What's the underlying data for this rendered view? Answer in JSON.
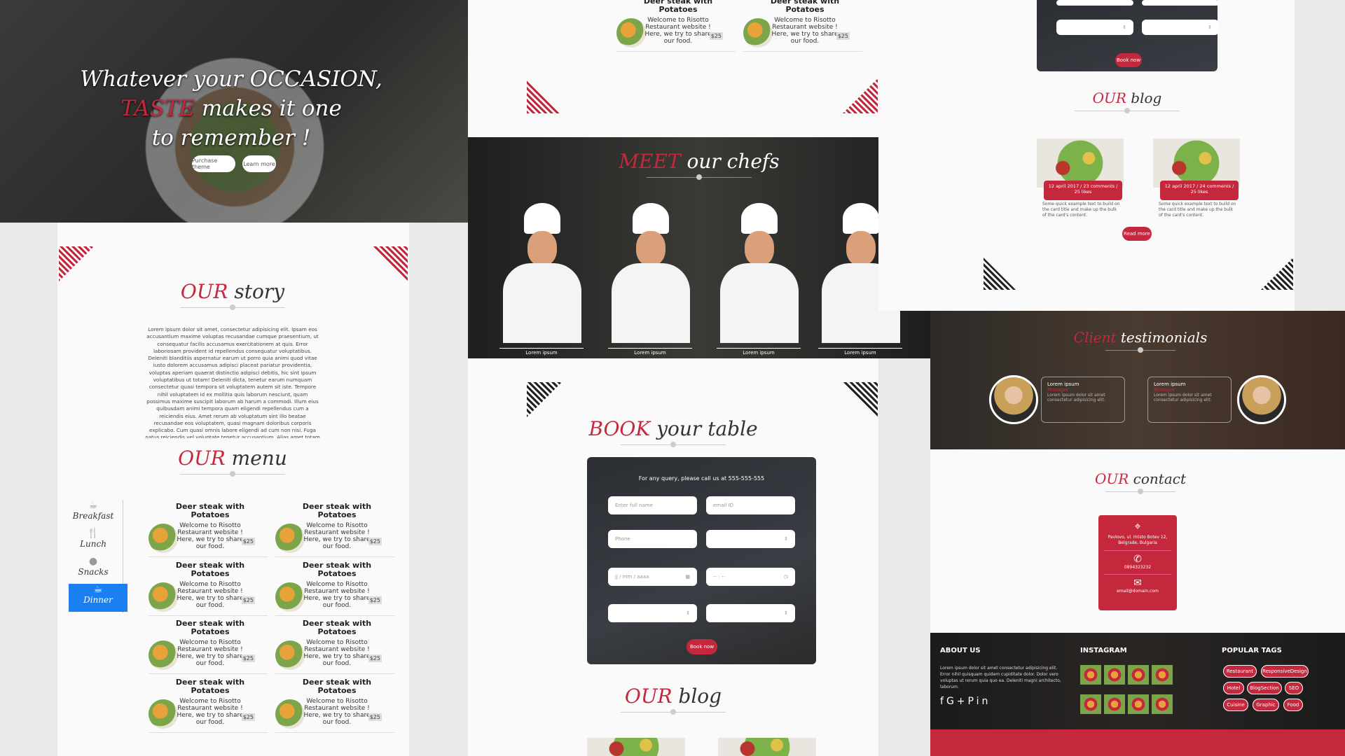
{
  "hero": {
    "line1": "Whatever your OCCASION,",
    "accent": "TASTE",
    "line2_rest": " makes it one",
    "line3": "to remember !",
    "btn_purchase": "Purchase theme",
    "btn_learn": "Learn more"
  },
  "story": {
    "h_accent": "OUR",
    "h_rest": " story",
    "body": "Lorem ipsum dolor sit amet, consectetur adipisicing elit. Ipsam eos accusantium maxime voluptas recusandae cumque praesentium, ut consequatur facilis accusamus exercitationem at quis. Error laboriosam provident id repellendus consequatur voluptatibus. Deleniti blanditiis aspernatur earum ut porro quia animi quod vitae iusto dolorem accusamus adipisci placeat pariatur providentia, voluptas aperiam quaerat distinctio adipisci debitis, hic sint ipsum voluptatibus ut totam! Deleniti dicta, tenetur earum numquam consectetur quasi tempora sit voluptatem autem sit iste. Tempore nihil voluptatem id ex mollitia quis laborum nesciunt, quam possimus maxime suscipit laborum ab harum a commodi. Illum eius quibusdam animi tempora quam eligendi repellendus cum a reiciendis eius. Amet rerum ab voluptatum sint illo beatae recusandae eos voluptatem, quasi magnam doloribus corporis explicabo. Cum quasi omnis labore eligendi ad cum non nisi. Fuga natus reiciendis vel voluptate tenetur accusantium. Alias amet totam nesciunt, quis magni."
  },
  "menu": {
    "h_accent": "OUR",
    "h_rest": " menu",
    "categories": [
      {
        "label": "Breakfast",
        "icon": "cup-icon"
      },
      {
        "label": "Lunch",
        "icon": "cutlery-icon"
      },
      {
        "label": "Snacks",
        "icon": "snack-icon"
      },
      {
        "label": "Dinner",
        "icon": "coffee-icon",
        "active": true
      }
    ],
    "items": [
      {
        "title": "Deer steak with Potatoes",
        "desc": "Welcome to Risotto Restaurant website ! Here, we try to share our food.",
        "price": "$25"
      },
      {
        "title": "Deer steak with Potatoes",
        "desc": "Welcome to Risotto Restaurant website ! Here, we try to share our food.",
        "price": "$25"
      },
      {
        "title": "Deer steak with Potatoes",
        "desc": "Welcome to Risotto Restaurant website ! Here, we try to share our food.",
        "price": "$25"
      },
      {
        "title": "Deer steak with Potatoes",
        "desc": "Welcome to Risotto Restaurant website ! Here, we try to share our food.",
        "price": "$25"
      },
      {
        "title": "Deer steak with Potatoes",
        "desc": "Welcome to Risotto Restaurant website ! Here, we try to share our food.",
        "price": "$25"
      },
      {
        "title": "Deer steak with Potatoes",
        "desc": "Welcome to Risotto Restaurant website ! Here, we try to share our food.",
        "price": "$25"
      },
      {
        "title": "Deer steak with Potatoes",
        "desc": "Welcome to Risotto Restaurant website ! Here, we try to share our food.",
        "price": "$25"
      },
      {
        "title": "Deer steak with Potatoes",
        "desc": "Welcome to Risotto Restaurant website ! Here, we try to share our food.",
        "price": "$25"
      }
    ],
    "top_items": [
      {
        "title": "Deer steak with Potatoes",
        "desc": "Welcome to Risotto Restaurant website ! Here, we try to share our food.",
        "price": "$25"
      },
      {
        "title": "Deer steak with Potatoes",
        "desc": "Welcome to Risotto Restaurant website ! Here, we try to share our food.",
        "price": "$25"
      }
    ]
  },
  "chefs": {
    "h_accent": "MEET",
    "h_rest": " our chefs",
    "names": [
      "Lorem ipsum",
      "Lorem ipsum",
      "Lorem ipsum",
      "Lorem ipsum"
    ]
  },
  "book": {
    "h_accent": "BOOK",
    "h_rest": " your table",
    "query": "For any query, please call us at 555-555-555",
    "name_ph": "Enter full name",
    "email_ph": "email ID",
    "phone_ph": "Phone",
    "date_ph": "jj / mm / aaaa",
    "time_ph": "-- : --",
    "btn": "Book now"
  },
  "blog": {
    "h_accent": "OUR",
    "h_rest": " blog",
    "posts": [
      {
        "meta": "12 april 2017 / 23 comments / 25 likes",
        "text": "Some quick example text to build on the card title and make up the bulk of the card's content."
      },
      {
        "meta": "12 april 2017 / 24 comments / 25 likes",
        "text": "Some quick example text to build on the card title and make up the bulk of the card's content."
      }
    ],
    "btn": "Read more"
  },
  "testimonials": {
    "h_accent": "Client",
    "h_rest": " testimonials",
    "cards": [
      {
        "name": "Lorem ipsum",
        "role": "Manager",
        "text": "Lorem ipsum dolor sit amet consectetur adipisicing elit."
      },
      {
        "name": "Lorem ipsum",
        "role": "Manager",
        "text": "Lorem ipsum dolor sit amet consectetur adipisicing elit."
      }
    ]
  },
  "contact": {
    "h_accent": "OUR",
    "h_rest": " contact",
    "address": "Pavlovo, ul. Hristo Botev 12, Belgrade, Bulgaria",
    "phone": "0894323232",
    "email": "email@domain.com"
  },
  "footer": {
    "about_title": "ABOUT US",
    "about_text": "Lorem ipsum dolor sit amet consectetur adipisicing elit. Error nihil quisquam quidem cupiditate dolor. Dolor vero voluptas ut rerum quia quo ea. Deleniti magni architecto, laborum.",
    "insta_title": "INSTAGRAM",
    "tags_title": "POPULAR TAGS",
    "tags": [
      "Restaurant",
      "ResponsiveDesign",
      "Hotel",
      "BlogSection",
      "SEO",
      "Cuisine",
      "Graphic",
      "Food"
    ]
  },
  "colors": {
    "accent": "#c5283d",
    "dark": "#262626"
  }
}
